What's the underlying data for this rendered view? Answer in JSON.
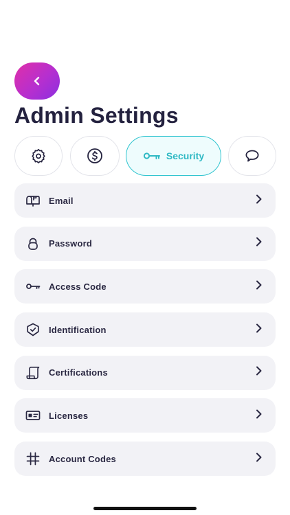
{
  "header": {
    "title": "Admin Settings"
  },
  "tabs": [
    {
      "icon": "gear-icon",
      "label": ""
    },
    {
      "icon": "dollar-icon",
      "label": ""
    },
    {
      "icon": "key-icon",
      "label": "Security",
      "active": true
    },
    {
      "icon": "chat-bubble-icon",
      "label": ""
    }
  ],
  "settings": {
    "items": [
      {
        "icon": "mailbox-icon",
        "label": "Email"
      },
      {
        "icon": "lock-icon",
        "label": "Password"
      },
      {
        "icon": "key-icon",
        "label": "Access Code"
      },
      {
        "icon": "shield-check-icon",
        "label": "Identification"
      },
      {
        "icon": "scroll-icon",
        "label": "Certifications"
      },
      {
        "icon": "id-card-icon",
        "label": "Licenses"
      },
      {
        "icon": "hash-icon",
        "label": "Account Codes"
      }
    ]
  },
  "colors": {
    "accent": "#2ec4cf",
    "back_gradient_start": "#e02fa8",
    "back_gradient_end": "#8b2fe0",
    "row_background": "#f2f2f6",
    "title": "#24223f"
  }
}
